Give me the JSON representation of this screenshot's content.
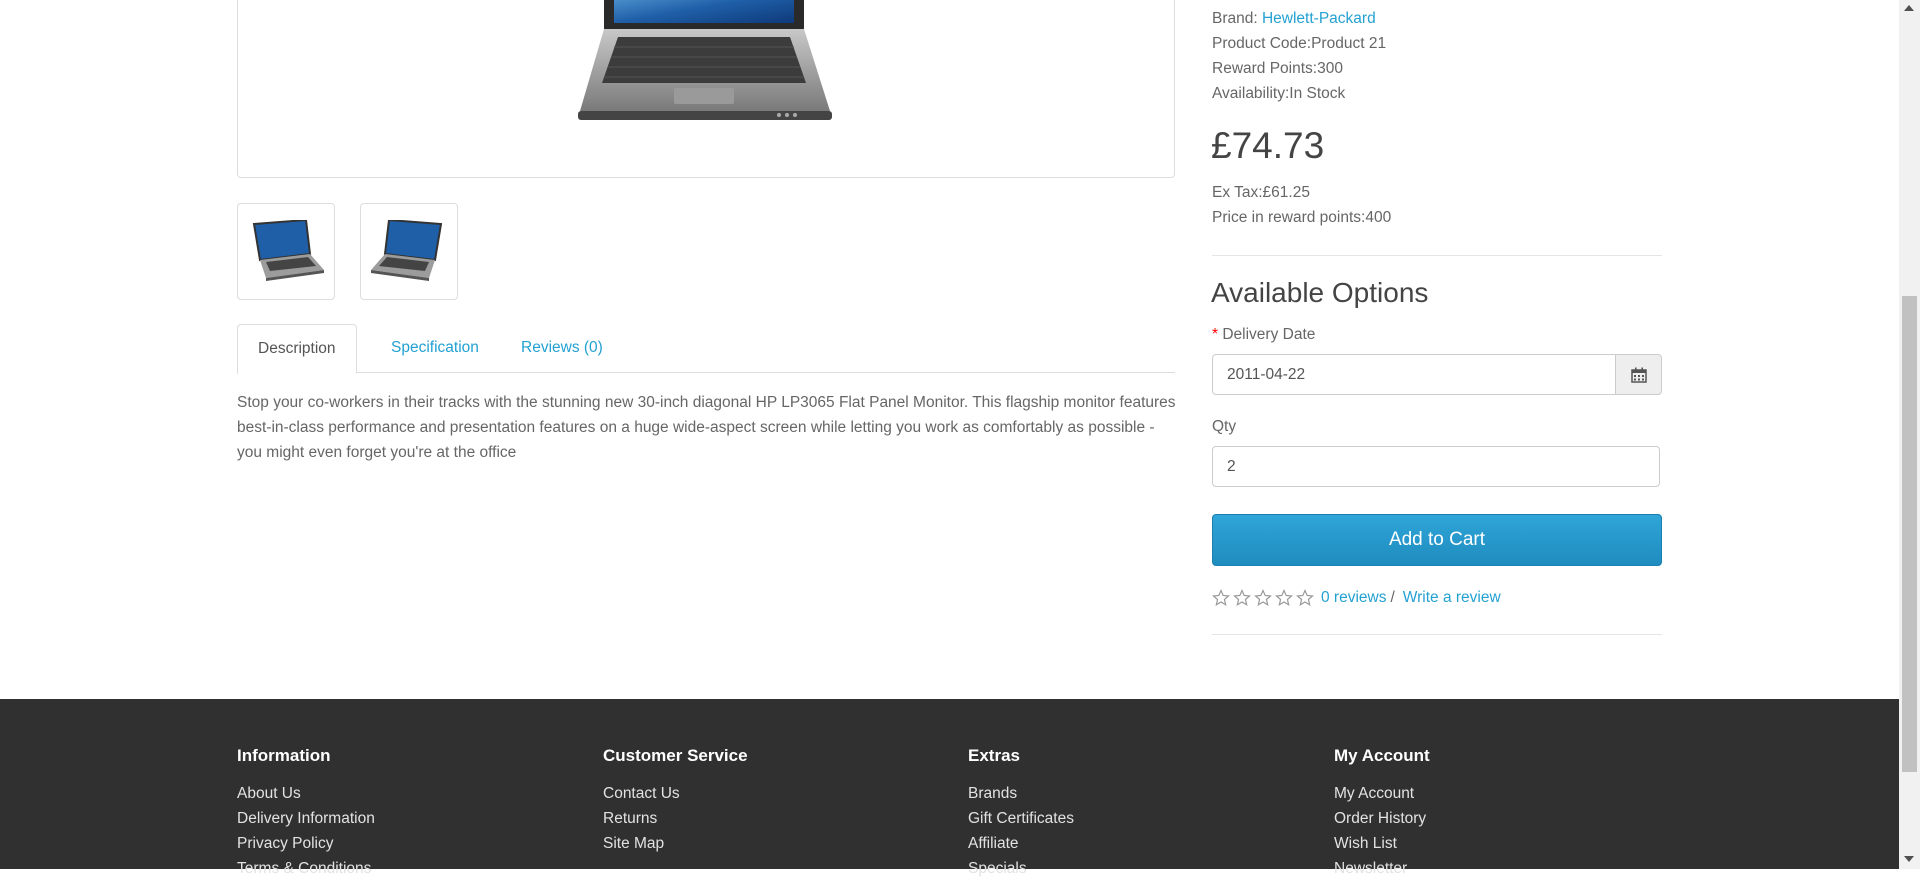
{
  "product": {
    "brand_label": "Brand:",
    "brand_value": "Hewlett-Packard",
    "code_label": "Product Code:",
    "code_value": "Product 21",
    "reward_label": "Reward Points:",
    "reward_value": "300",
    "availability_label": "Availability:",
    "availability_value": "In Stock",
    "price": "£74.73",
    "extax_label": "Ex Tax:",
    "extax_value": "£61.25",
    "price_points_label": "Price in reward points:",
    "price_points_value": "400"
  },
  "tabs": [
    {
      "label": "Description",
      "active": true
    },
    {
      "label": "Specification",
      "active": false
    },
    {
      "label": "Reviews (0)",
      "active": false
    }
  ],
  "description": "Stop your co-workers in their tracks with the stunning new 30-inch diagonal HP LP3065 Flat Panel Monitor. This flagship monitor features best-in-class performance and presentation features on a huge wide-aspect screen while letting you work as comfortably as possible - you might even forget you're at the office",
  "options": {
    "title": "Available Options",
    "required_mark": "*",
    "delivery_label": "Delivery Date",
    "delivery_value": "2011-04-22",
    "qty_label": "Qty",
    "qty_value": "2",
    "add_to_cart": "Add to Cart"
  },
  "rating": {
    "stars_filled": 0,
    "stars_total": 5,
    "reviews_link": "0 reviews",
    "separator": "/",
    "write_review": "Write a review"
  },
  "footer": {
    "columns": [
      {
        "title": "Information",
        "links": [
          "About Us",
          "Delivery Information",
          "Privacy Policy",
          "Terms & Conditions"
        ]
      },
      {
        "title": "Customer Service",
        "links": [
          "Contact Us",
          "Returns",
          "Site Map"
        ]
      },
      {
        "title": "Extras",
        "links": [
          "Brands",
          "Gift Certificates",
          "Affiliate",
          "Specials"
        ]
      },
      {
        "title": "My Account",
        "links": [
          "My Account",
          "Order History",
          "Wish List",
          "Newsletter"
        ]
      }
    ]
  },
  "icons": {
    "calendar": "calendar-icon",
    "star": "star-outline-icon"
  },
  "colors": {
    "link": "#23a1d1",
    "button": "#229ac8",
    "footer_bg": "#303030",
    "required": "#ff0000"
  }
}
